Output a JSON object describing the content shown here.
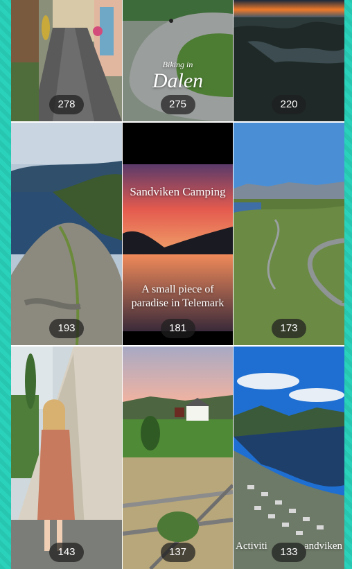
{
  "tiles": [
    {
      "count": "278"
    },
    {
      "count": "275",
      "caption_small": "Biking in",
      "caption_large": "Dalen"
    },
    {
      "count": "220"
    },
    {
      "count": "193"
    },
    {
      "count": "181",
      "caption_top": "Sandviken Camping",
      "caption_bottom_1": "A small piece of",
      "caption_bottom_2": "paradise in Telemark"
    },
    {
      "count": "173"
    },
    {
      "count": "143"
    },
    {
      "count": "137"
    },
    {
      "count": "133",
      "caption_left": "Activiti",
      "caption_right": "andviken"
    }
  ]
}
